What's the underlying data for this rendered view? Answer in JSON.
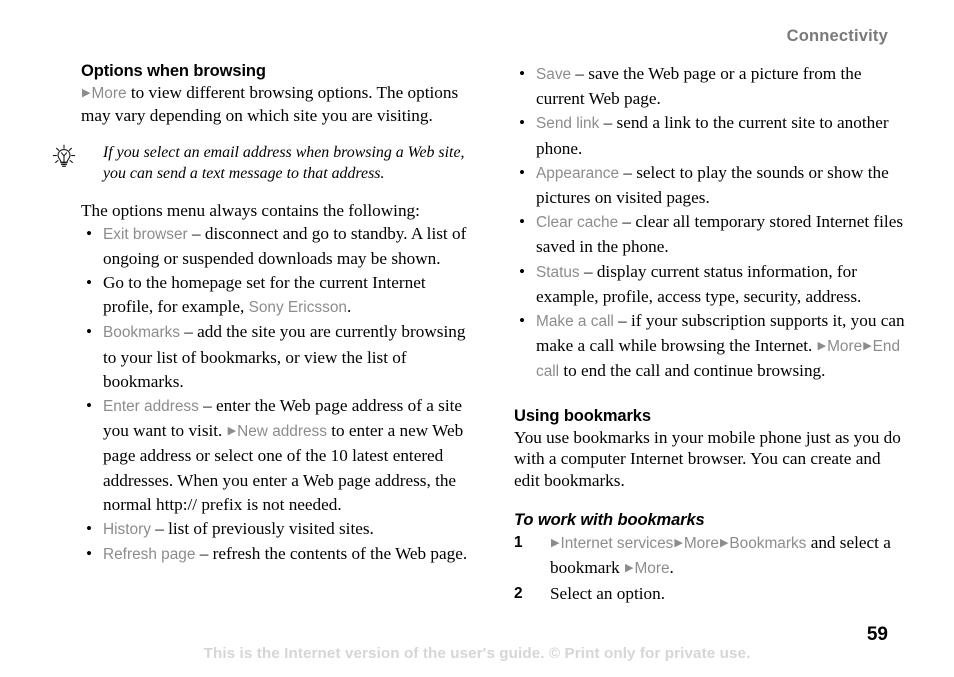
{
  "header": {
    "running_head": "Connectivity"
  },
  "left_column": {
    "section_title": "Options when browsing",
    "intro": {
      "arrow": "▶",
      "ui_more": "More",
      "text_after": " to view different browsing options. The options may vary depending on which site you are visiting."
    },
    "tip": {
      "icon": "lightbulb-icon",
      "text": "If you select an email address when browsing a Web site, you can send a text message to that address."
    },
    "list_intro": "The options menu always contains the following:",
    "bullets": [
      {
        "bullet": "•",
        "ui_term": "Exit browser",
        "text": " – disconnect and go to standby. A list of ongoing or suspended downloads may be shown."
      },
      {
        "bullet": "•",
        "text_before": "Go to the homepage set for the current Internet profile, for example, ",
        "ui_term": "Sony Ericsson",
        "text_after": "."
      },
      {
        "bullet": "•",
        "ui_term": "Bookmarks",
        "text": " – add the site you are currently browsing to your list of bookmarks, or view the list of bookmarks."
      },
      {
        "bullet": "•",
        "ui_term": "Enter address",
        "text": " – enter the Web page address of a site you want to visit. ",
        "arrow": "▶",
        "ui_term2": "New address",
        "text2": " to enter a new Web page address or select one of the 10 latest entered addresses. When you enter a Web page address, the normal http:// prefix is not needed."
      },
      {
        "bullet": "•",
        "ui_term": "History",
        "text": " – list of previously visited sites."
      },
      {
        "bullet": "•",
        "ui_term": "Refresh page",
        "text": " – refresh the contents of the Web page."
      }
    ]
  },
  "right_column": {
    "bullets": [
      {
        "bullet": "•",
        "ui_term": "Save",
        "text": " – save the Web page or a picture from the current Web page."
      },
      {
        "bullet": "•",
        "ui_term": "Send link",
        "text": " – send a link to the current site to another phone."
      },
      {
        "bullet": "•",
        "ui_term": "Appearance",
        "text": " – select to play the sounds or show the pictures on visited pages."
      },
      {
        "bullet": "•",
        "ui_term": "Clear cache",
        "text": " – clear all temporary stored Internet files saved in the phone."
      },
      {
        "bullet": "•",
        "ui_term": "Status",
        "text": " – display current status information, for example, profile, access type, security, address."
      },
      {
        "bullet": "•",
        "ui_term": "Make a call",
        "text": " – if your subscription supports it, you can make a call while browsing the Internet. ",
        "arrow1": "▶",
        "ui_term2": "More",
        "arrow2": "▶",
        "ui_term3": "End call",
        "text2": " to end the call and continue browsing."
      }
    ],
    "section_title": "Using bookmarks",
    "body": "You use bookmarks in your mobile phone just as you do with a computer Internet browser. You can create and edit bookmarks.",
    "procedure_title": "To work with bookmarks",
    "steps": [
      {
        "num": "1",
        "arrow1": "▶",
        "ui_term1": "Internet services",
        "arrow2": "▶",
        "ui_term2": "More",
        "arrow3": "▶",
        "ui_term3": "Bookmarks",
        "text_mid": " and select a bookmark ",
        "arrow4": "▶",
        "ui_term4": "More",
        "text_end": "."
      },
      {
        "num": "2",
        "text": "Select an option."
      }
    ]
  },
  "footer": {
    "note": "This is the Internet version of the user's guide. © Print only for private use.",
    "page_number": "59"
  },
  "colors": {
    "ui_term_grey": "#8c8c8c",
    "running_head_grey": "#7a7a7a",
    "footer_grey": "#d6d6d6",
    "body_black": "#000000"
  }
}
